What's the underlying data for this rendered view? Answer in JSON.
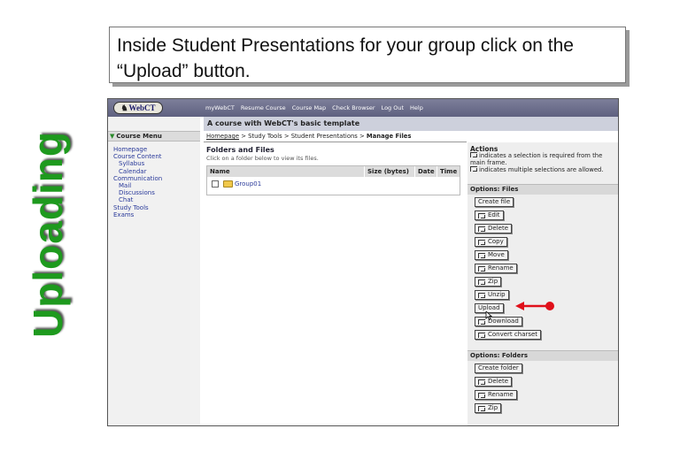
{
  "slide": {
    "side_title": "Uploading",
    "instruction": "Inside Student Presentations for your group click on the “Upload” button."
  },
  "colors": {
    "side_title": "#1e9a1e",
    "topbar": "#6a6c8a",
    "arrow": "#e0101a",
    "link": "#2a3a9a"
  },
  "app": {
    "logo_text": "WebCT",
    "top_nav": [
      "myWebCT",
      "Resume Course",
      "Course Map",
      "Check Browser",
      "Log Out",
      "Help"
    ],
    "course_title": "A course with WebCT's basic template"
  },
  "course_menu": {
    "header": "Course Menu",
    "items": [
      {
        "label": "Homepage",
        "sub": false
      },
      {
        "label": "Course Content",
        "sub": false
      },
      {
        "label": "Syllabus",
        "sub": true
      },
      {
        "label": "Calendar",
        "sub": true
      },
      {
        "label": "Communication",
        "sub": false
      },
      {
        "label": "Mail",
        "sub": true
      },
      {
        "label": "Discussions",
        "sub": true
      },
      {
        "label": "Chat",
        "sub": true
      },
      {
        "label": "Study Tools",
        "sub": false
      },
      {
        "label": "Exams",
        "sub": false
      }
    ]
  },
  "breadcrumb": {
    "home": "Homepage",
    "sep": ">",
    "study_tools": "Study Tools",
    "student_presentations": "Student Presentations",
    "current": "Manage Files"
  },
  "main": {
    "heading": "Folders and Files",
    "subtext": "Click on a folder below to view its files.",
    "columns": [
      "Name",
      "Size (bytes)",
      "Date",
      "Time"
    ],
    "rows": [
      {
        "name": "Group01",
        "size": "",
        "date": "",
        "time": ""
      }
    ]
  },
  "actions": {
    "title": "Actions",
    "note_single": "indicates a selection is required from the main frame.",
    "note_multi": "indicates multiple selections are allowed.",
    "files_header": "Options: Files",
    "file_buttons": [
      "Create file",
      "Edit",
      "Delete",
      "Copy",
      "Move",
      "Rename",
      "Zip",
      "Unzip",
      "Upload",
      "Download",
      "Convert charset"
    ],
    "folders_header": "Options: Folders",
    "folder_buttons": [
      "Create folder",
      "Delete",
      "Rename",
      "Zip"
    ]
  }
}
